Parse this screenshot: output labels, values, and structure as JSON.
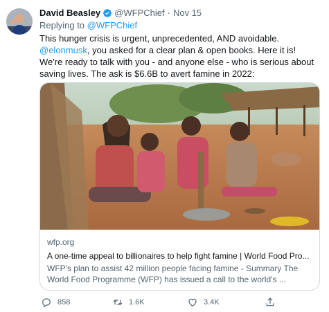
{
  "tweet": {
    "author_name": "David Beasley",
    "handle": "@WFPChief",
    "separator": "·",
    "date": "Nov 15",
    "replying_prefix": "Replying to",
    "replying_to": "@WFPChief",
    "text_part1": "This hunger crisis is urgent, unprecedented, AND avoidable.",
    "text_mention": "@elonmusk",
    "text_part2": ", you asked for a clear plan & open books. Here it is! We're ready to talk with you - and anyone else - who is serious about saving lives. The ask is $6.6B to avert famine in 2022:"
  },
  "card": {
    "domain": "wfp.org",
    "title": "A one-time appeal to billionaires to help fight famine | World Food Pro...",
    "description": "WFP's plan to assist 42 million people facing famine - Summary The World Food Programme (WFP) has issued a call to the world's ..."
  },
  "actions": {
    "reply_count": "858",
    "retweet_count": "1.6K",
    "like_count": "3.4K"
  },
  "icons": [
    "verified-badge-icon",
    "reply-icon",
    "retweet-icon",
    "like-icon",
    "share-icon"
  ],
  "colors": {
    "accent": "#1d9bf0",
    "secondary_text": "#536471",
    "border": "#cfd9de"
  }
}
